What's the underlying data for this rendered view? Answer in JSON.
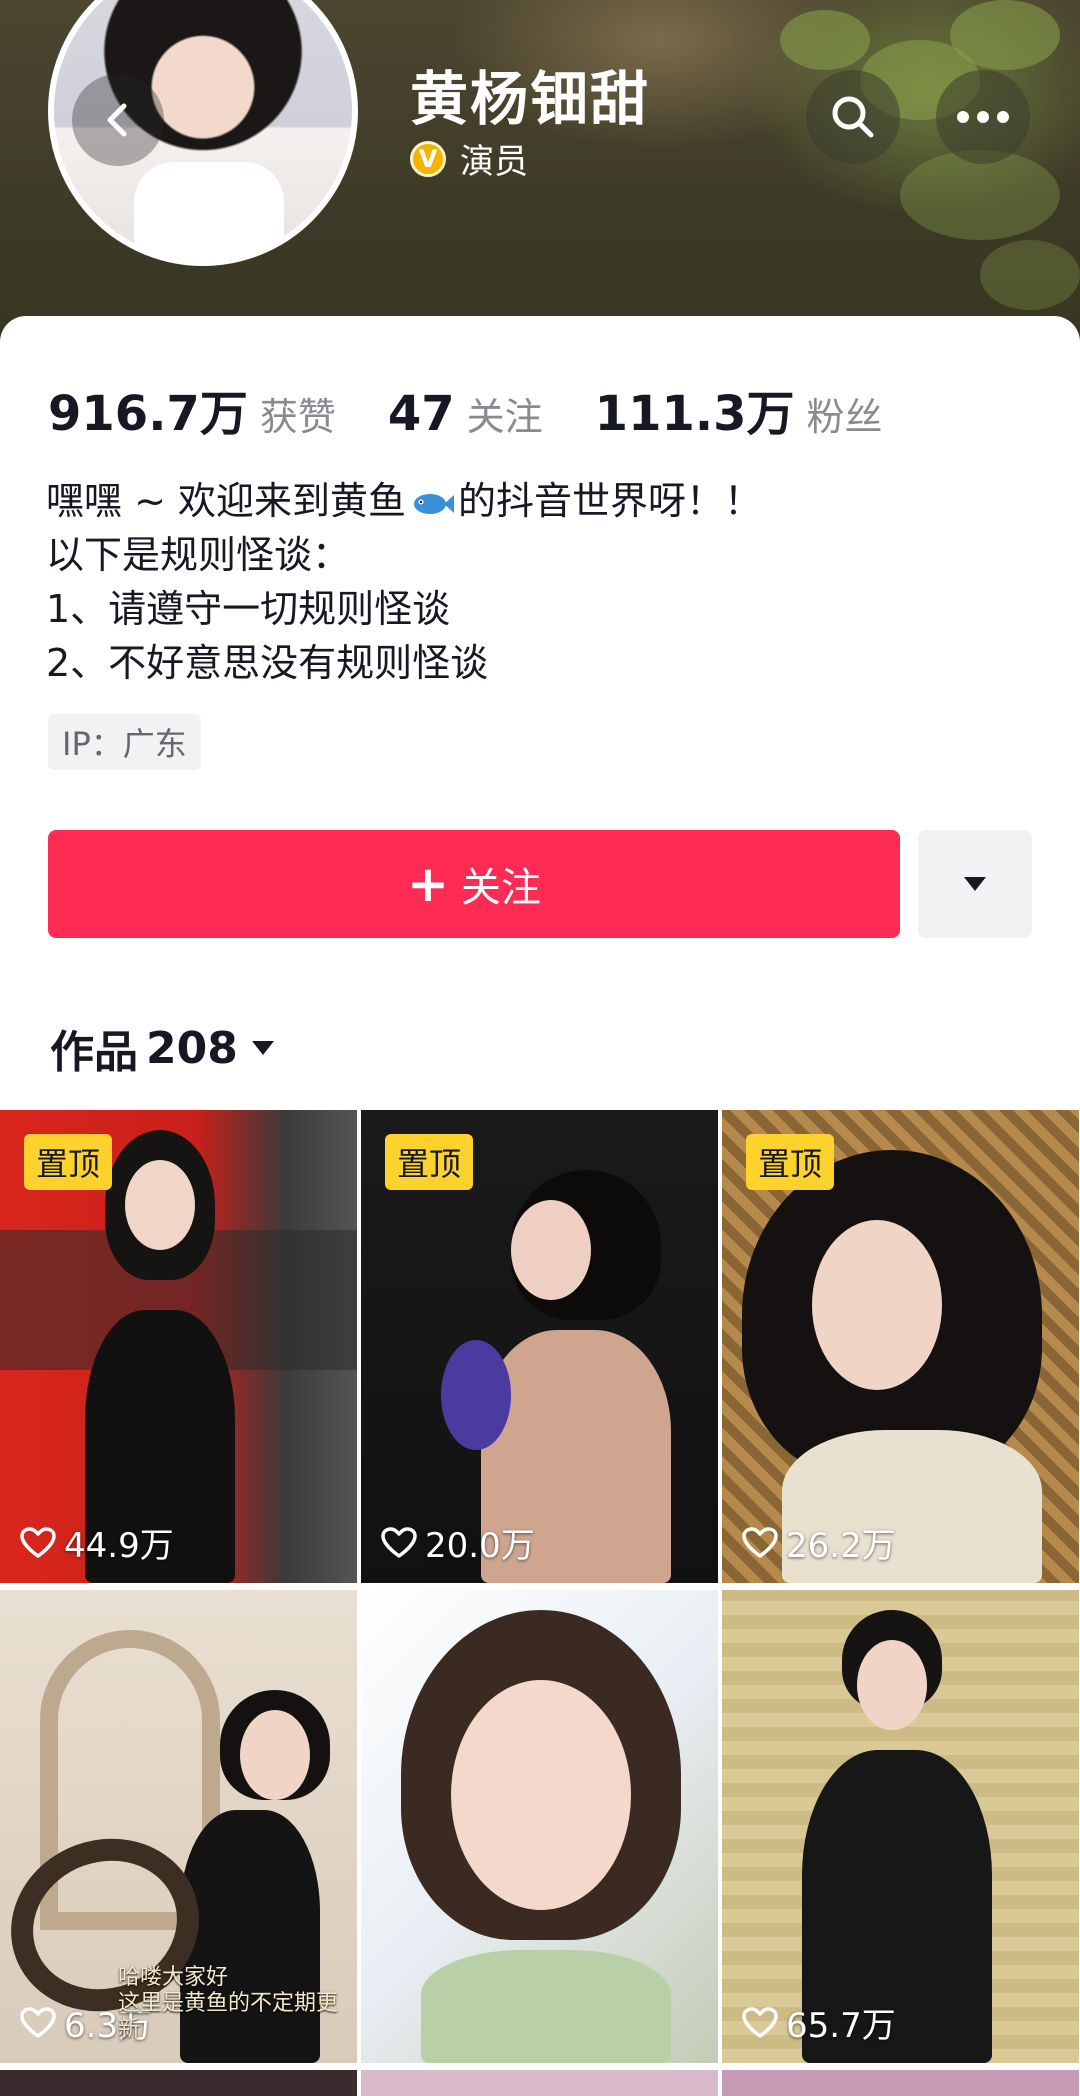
{
  "profile": {
    "name": "黄杨钿甜",
    "verified_badge": "V",
    "role": "演员"
  },
  "stats": [
    {
      "value": "916.7万",
      "label": "获赞"
    },
    {
      "value": "47",
      "label": "关注"
    },
    {
      "value": "111.3万",
      "label": "粉丝"
    }
  ],
  "bio": {
    "line1_a": "嘿嘿 ~ 欢迎来到黄鱼",
    "line1_b": "的抖音世界呀！！",
    "line2": "以下是规则怪谈：",
    "line3": "1、请遵守一切规则怪谈",
    "line4": "2、不好意思没有规则怪谈"
  },
  "ip_tag": "IP：广东",
  "actions": {
    "follow_plus": "+",
    "follow_label": "关注"
  },
  "works": {
    "label": "作品",
    "count": "208"
  },
  "pin_label": "置顶",
  "videos": [
    {
      "likes": "44.9万",
      "pinned": true
    },
    {
      "likes": "20.0万",
      "pinned": true
    },
    {
      "likes": "26.2万",
      "pinned": true
    },
    {
      "likes": "6.3万",
      "pinned": false,
      "caption_1": "哈喽大家好",
      "caption_2": "这里是黄鱼的不定期更新"
    },
    {
      "likes": "",
      "pinned": false
    },
    {
      "likes": "65.7万",
      "pinned": false
    }
  ],
  "colors": {
    "follow_button": "#fe2c55",
    "pin_badge": "#fdd22d",
    "verified_badge": "#f4b400"
  },
  "icons": [
    "back-arrow-icon",
    "search-icon",
    "more-icon",
    "caret-down-icon",
    "heart-icon",
    "fish-emoji"
  ]
}
